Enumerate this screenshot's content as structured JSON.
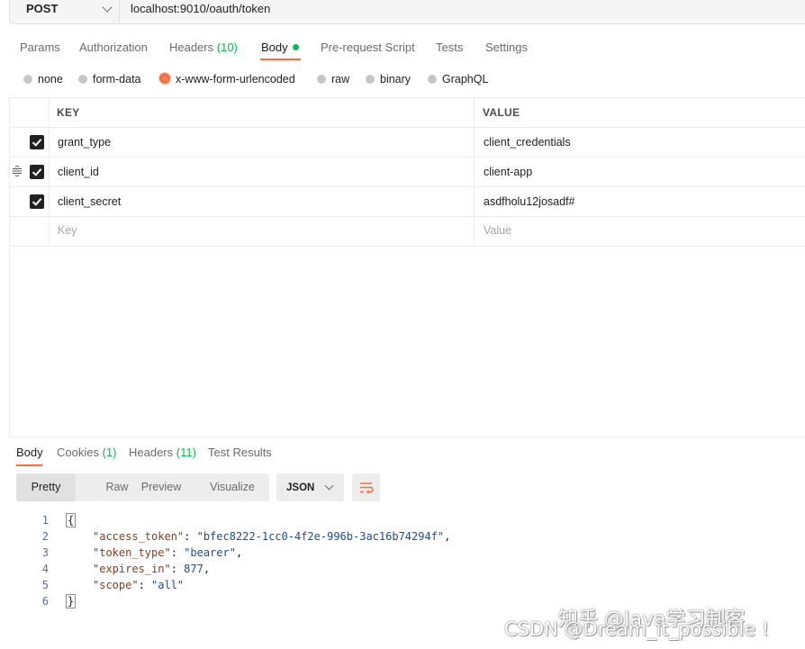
{
  "request": {
    "method": "POST",
    "url": "localhost:9010/oauth/token"
  },
  "request_tabs": [
    {
      "label": "Params"
    },
    {
      "label": "Authorization"
    },
    {
      "label": "Headers",
      "count": "(10)"
    },
    {
      "label": "Body"
    },
    {
      "label": "Pre-request Script"
    },
    {
      "label": "Tests"
    },
    {
      "label": "Settings"
    }
  ],
  "body_types": [
    {
      "label": "none",
      "selected": false
    },
    {
      "label": "form-data",
      "selected": false
    },
    {
      "label": "x-www-form-urlencoded",
      "selected": true
    },
    {
      "label": "raw",
      "selected": false
    },
    {
      "label": "binary",
      "selected": false
    },
    {
      "label": "GraphQL",
      "selected": false
    }
  ],
  "table": {
    "headers": {
      "key": "KEY",
      "value": "VALUE"
    },
    "rows": [
      {
        "key": "grant_type",
        "value": "client_credentials",
        "checked": true
      },
      {
        "key": "client_id",
        "value": "client-app",
        "checked": true
      },
      {
        "key": "client_secret",
        "value": "asdfholu12josadf#",
        "checked": true
      }
    ],
    "placeholder": {
      "key": "Key",
      "value": "Value"
    }
  },
  "response_tabs": [
    {
      "label": "Body"
    },
    {
      "label": "Cookies",
      "count": "(1)"
    },
    {
      "label": "Headers",
      "count": "(11)"
    },
    {
      "label": "Test Results"
    }
  ],
  "view_modes": [
    "Pretty",
    "Raw",
    "Preview",
    "Visualize"
  ],
  "format": "JSON",
  "code_lines": [
    {
      "n": "1",
      "open": "{"
    },
    {
      "n": "2",
      "key": "\"access_token\"",
      "val": "\"bfec8222-1cc0-4f2e-996b-3ac16b74294f\"",
      "end": ","
    },
    {
      "n": "3",
      "key": "\"token_type\"",
      "val": "\"bearer\"",
      "end": ","
    },
    {
      "n": "4",
      "key": "\"expires_in\"",
      "val": "877",
      "end": ","
    },
    {
      "n": "5",
      "key": "\"scope\"",
      "val": "\"all\"",
      "end": ""
    },
    {
      "n": "6",
      "close": "}"
    }
  ],
  "watermark": {
    "line1": "知乎 @Java学习制客",
    "line2": "CSDN @Dream_it_possible !"
  },
  "colors": {
    "accent": "#ff6c37",
    "count_green": "#0cbb52"
  }
}
